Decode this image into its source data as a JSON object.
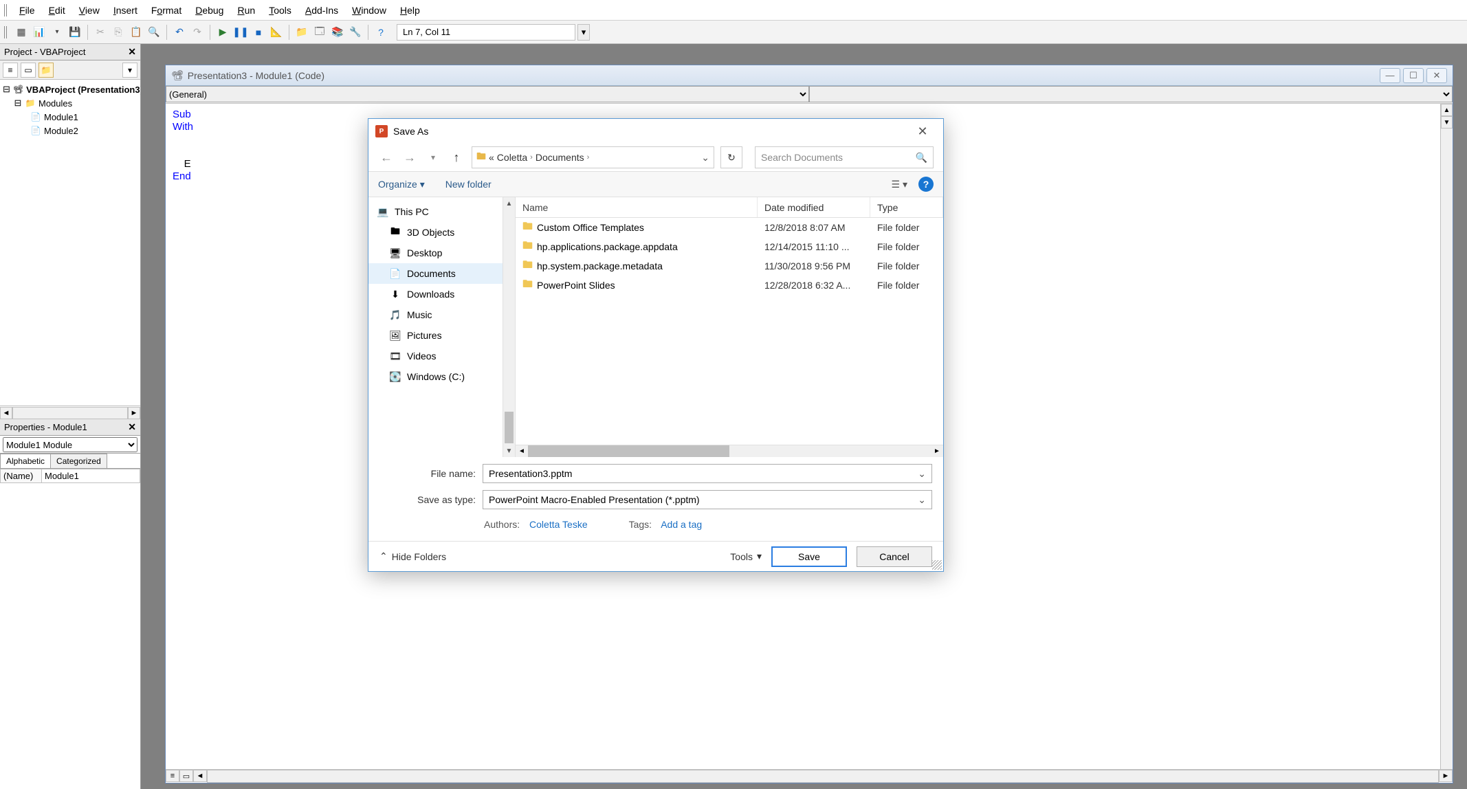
{
  "menubar": {
    "items": [
      {
        "label": "File",
        "accel": "F"
      },
      {
        "label": "Edit",
        "accel": "E"
      },
      {
        "label": "View",
        "accel": "V"
      },
      {
        "label": "Insert",
        "accel": "I"
      },
      {
        "label": "Format",
        "accel": "o"
      },
      {
        "label": "Debug",
        "accel": "D"
      },
      {
        "label": "Run",
        "accel": "R"
      },
      {
        "label": "Tools",
        "accel": "T"
      },
      {
        "label": "Add-Ins",
        "accel": "A"
      },
      {
        "label": "Window",
        "accel": "W"
      },
      {
        "label": "Help",
        "accel": "H"
      }
    ]
  },
  "toolbar": {
    "status": "Ln 7, Col 11"
  },
  "project_pane": {
    "title": "Project - VBAProject",
    "root": "VBAProject (Presentation3)",
    "modules_folder": "Modules",
    "modules": [
      "Module1",
      "Module2"
    ]
  },
  "properties_pane": {
    "title": "Properties - Module1",
    "object": "Module1 Module",
    "tabs": {
      "alpha": "Alphabetic",
      "cat": "Categorized"
    },
    "rows": [
      {
        "name": "(Name)",
        "value": "Module1"
      }
    ]
  },
  "code_window": {
    "title": "Presentation3 - Module1 (Code)",
    "left_dropdown": "(General)",
    "right_dropdown": "",
    "lines": [
      {
        "kw": "Sub"
      },
      {
        "kw": "With"
      },
      {
        "plain": "    E"
      },
      {
        "kw": "End"
      }
    ]
  },
  "save_dialog": {
    "title": "Save As",
    "breadcrumb": {
      "ellipsis": "«",
      "p1": "Coletta",
      "p2": "Documents"
    },
    "search_placeholder": "Search Documents",
    "organize": "Organize",
    "new_folder": "New folder",
    "nav_items": [
      {
        "label": "This PC",
        "icon": "pc",
        "indent": false,
        "selected": false
      },
      {
        "label": "3D Objects",
        "icon": "folder",
        "indent": true,
        "selected": false
      },
      {
        "label": "Desktop",
        "icon": "desktop",
        "indent": true,
        "selected": false
      },
      {
        "label": "Documents",
        "icon": "doc",
        "indent": true,
        "selected": true
      },
      {
        "label": "Downloads",
        "icon": "down",
        "indent": true,
        "selected": false
      },
      {
        "label": "Music",
        "icon": "music",
        "indent": true,
        "selected": false
      },
      {
        "label": "Pictures",
        "icon": "pic",
        "indent": true,
        "selected": false
      },
      {
        "label": "Videos",
        "icon": "vid",
        "indent": true,
        "selected": false
      },
      {
        "label": "Windows (C:)",
        "icon": "drive",
        "indent": true,
        "selected": false
      }
    ],
    "columns": {
      "name": "Name",
      "date": "Date modified",
      "type": "Type"
    },
    "files": [
      {
        "name": "Custom Office Templates",
        "date": "12/8/2018 8:07 AM",
        "type": "File folder"
      },
      {
        "name": "hp.applications.package.appdata",
        "date": "12/14/2015 11:10 ...",
        "type": "File folder"
      },
      {
        "name": "hp.system.package.metadata",
        "date": "11/30/2018 9:56 PM",
        "type": "File folder"
      },
      {
        "name": "PowerPoint Slides",
        "date": "12/28/2018 6:32 A...",
        "type": "File folder"
      }
    ],
    "filename_label": "File name:",
    "filename_value": "Presentation3.pptm",
    "savetype_label": "Save as type:",
    "savetype_value": "PowerPoint Macro-Enabled Presentation (*.pptm)",
    "authors_label": "Authors:",
    "authors_value": "Coletta Teske",
    "tags_label": "Tags:",
    "tags_value": "Add a tag",
    "hide_folders": "Hide Folders",
    "tools": "Tools",
    "save": "Save",
    "cancel": "Cancel"
  }
}
